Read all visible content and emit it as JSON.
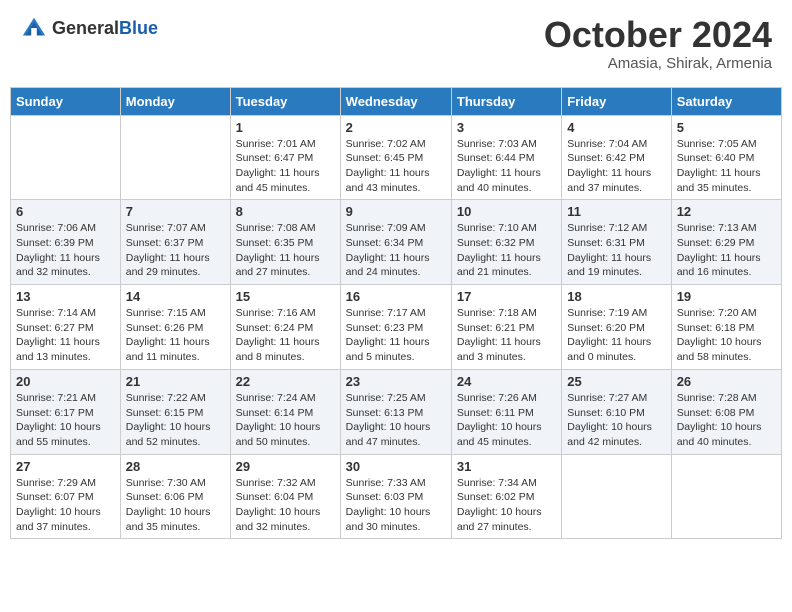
{
  "header": {
    "logo_general": "General",
    "logo_blue": "Blue",
    "month": "October 2024",
    "location": "Amasia, Shirak, Armenia"
  },
  "days_of_week": [
    "Sunday",
    "Monday",
    "Tuesday",
    "Wednesday",
    "Thursday",
    "Friday",
    "Saturday"
  ],
  "weeks": [
    [
      {
        "day": null
      },
      {
        "day": null
      },
      {
        "day": 1,
        "sunrise": "Sunrise: 7:01 AM",
        "sunset": "Sunset: 6:47 PM",
        "daylight": "Daylight: 11 hours and 45 minutes."
      },
      {
        "day": 2,
        "sunrise": "Sunrise: 7:02 AM",
        "sunset": "Sunset: 6:45 PM",
        "daylight": "Daylight: 11 hours and 43 minutes."
      },
      {
        "day": 3,
        "sunrise": "Sunrise: 7:03 AM",
        "sunset": "Sunset: 6:44 PM",
        "daylight": "Daylight: 11 hours and 40 minutes."
      },
      {
        "day": 4,
        "sunrise": "Sunrise: 7:04 AM",
        "sunset": "Sunset: 6:42 PM",
        "daylight": "Daylight: 11 hours and 37 minutes."
      },
      {
        "day": 5,
        "sunrise": "Sunrise: 7:05 AM",
        "sunset": "Sunset: 6:40 PM",
        "daylight": "Daylight: 11 hours and 35 minutes."
      }
    ],
    [
      {
        "day": 6,
        "sunrise": "Sunrise: 7:06 AM",
        "sunset": "Sunset: 6:39 PM",
        "daylight": "Daylight: 11 hours and 32 minutes."
      },
      {
        "day": 7,
        "sunrise": "Sunrise: 7:07 AM",
        "sunset": "Sunset: 6:37 PM",
        "daylight": "Daylight: 11 hours and 29 minutes."
      },
      {
        "day": 8,
        "sunrise": "Sunrise: 7:08 AM",
        "sunset": "Sunset: 6:35 PM",
        "daylight": "Daylight: 11 hours and 27 minutes."
      },
      {
        "day": 9,
        "sunrise": "Sunrise: 7:09 AM",
        "sunset": "Sunset: 6:34 PM",
        "daylight": "Daylight: 11 hours and 24 minutes."
      },
      {
        "day": 10,
        "sunrise": "Sunrise: 7:10 AM",
        "sunset": "Sunset: 6:32 PM",
        "daylight": "Daylight: 11 hours and 21 minutes."
      },
      {
        "day": 11,
        "sunrise": "Sunrise: 7:12 AM",
        "sunset": "Sunset: 6:31 PM",
        "daylight": "Daylight: 11 hours and 19 minutes."
      },
      {
        "day": 12,
        "sunrise": "Sunrise: 7:13 AM",
        "sunset": "Sunset: 6:29 PM",
        "daylight": "Daylight: 11 hours and 16 minutes."
      }
    ],
    [
      {
        "day": 13,
        "sunrise": "Sunrise: 7:14 AM",
        "sunset": "Sunset: 6:27 PM",
        "daylight": "Daylight: 11 hours and 13 minutes."
      },
      {
        "day": 14,
        "sunrise": "Sunrise: 7:15 AM",
        "sunset": "Sunset: 6:26 PM",
        "daylight": "Daylight: 11 hours and 11 minutes."
      },
      {
        "day": 15,
        "sunrise": "Sunrise: 7:16 AM",
        "sunset": "Sunset: 6:24 PM",
        "daylight": "Daylight: 11 hours and 8 minutes."
      },
      {
        "day": 16,
        "sunrise": "Sunrise: 7:17 AM",
        "sunset": "Sunset: 6:23 PM",
        "daylight": "Daylight: 11 hours and 5 minutes."
      },
      {
        "day": 17,
        "sunrise": "Sunrise: 7:18 AM",
        "sunset": "Sunset: 6:21 PM",
        "daylight": "Daylight: 11 hours and 3 minutes."
      },
      {
        "day": 18,
        "sunrise": "Sunrise: 7:19 AM",
        "sunset": "Sunset: 6:20 PM",
        "daylight": "Daylight: 11 hours and 0 minutes."
      },
      {
        "day": 19,
        "sunrise": "Sunrise: 7:20 AM",
        "sunset": "Sunset: 6:18 PM",
        "daylight": "Daylight: 10 hours and 58 minutes."
      }
    ],
    [
      {
        "day": 20,
        "sunrise": "Sunrise: 7:21 AM",
        "sunset": "Sunset: 6:17 PM",
        "daylight": "Daylight: 10 hours and 55 minutes."
      },
      {
        "day": 21,
        "sunrise": "Sunrise: 7:22 AM",
        "sunset": "Sunset: 6:15 PM",
        "daylight": "Daylight: 10 hours and 52 minutes."
      },
      {
        "day": 22,
        "sunrise": "Sunrise: 7:24 AM",
        "sunset": "Sunset: 6:14 PM",
        "daylight": "Daylight: 10 hours and 50 minutes."
      },
      {
        "day": 23,
        "sunrise": "Sunrise: 7:25 AM",
        "sunset": "Sunset: 6:13 PM",
        "daylight": "Daylight: 10 hours and 47 minutes."
      },
      {
        "day": 24,
        "sunrise": "Sunrise: 7:26 AM",
        "sunset": "Sunset: 6:11 PM",
        "daylight": "Daylight: 10 hours and 45 minutes."
      },
      {
        "day": 25,
        "sunrise": "Sunrise: 7:27 AM",
        "sunset": "Sunset: 6:10 PM",
        "daylight": "Daylight: 10 hours and 42 minutes."
      },
      {
        "day": 26,
        "sunrise": "Sunrise: 7:28 AM",
        "sunset": "Sunset: 6:08 PM",
        "daylight": "Daylight: 10 hours and 40 minutes."
      }
    ],
    [
      {
        "day": 27,
        "sunrise": "Sunrise: 7:29 AM",
        "sunset": "Sunset: 6:07 PM",
        "daylight": "Daylight: 10 hours and 37 minutes."
      },
      {
        "day": 28,
        "sunrise": "Sunrise: 7:30 AM",
        "sunset": "Sunset: 6:06 PM",
        "daylight": "Daylight: 10 hours and 35 minutes."
      },
      {
        "day": 29,
        "sunrise": "Sunrise: 7:32 AM",
        "sunset": "Sunset: 6:04 PM",
        "daylight": "Daylight: 10 hours and 32 minutes."
      },
      {
        "day": 30,
        "sunrise": "Sunrise: 7:33 AM",
        "sunset": "Sunset: 6:03 PM",
        "daylight": "Daylight: 10 hours and 30 minutes."
      },
      {
        "day": 31,
        "sunrise": "Sunrise: 7:34 AM",
        "sunset": "Sunset: 6:02 PM",
        "daylight": "Daylight: 10 hours and 27 minutes."
      },
      {
        "day": null
      },
      {
        "day": null
      }
    ]
  ]
}
